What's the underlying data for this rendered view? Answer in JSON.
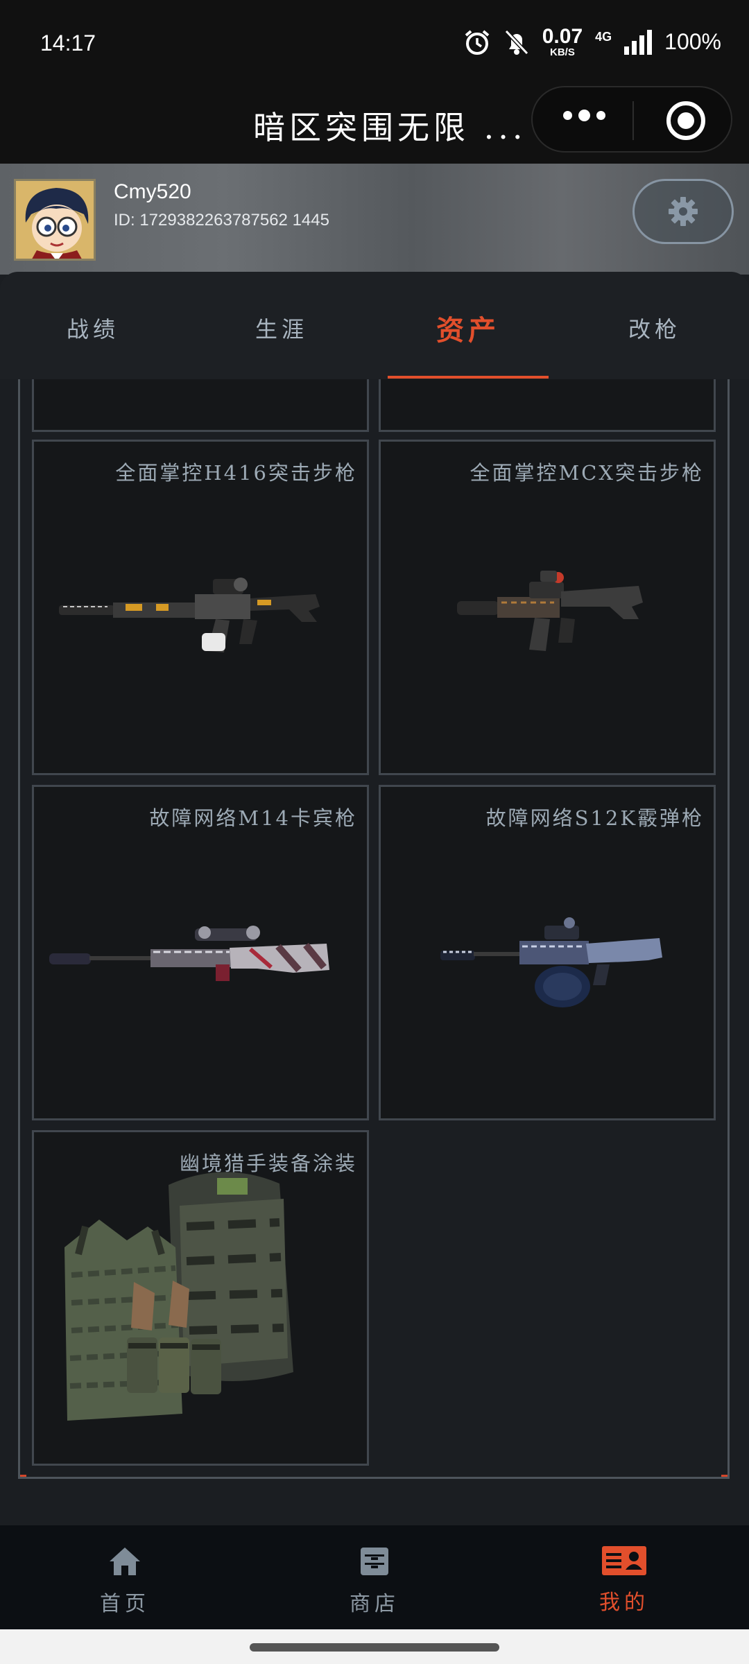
{
  "status_bar": {
    "time": "14:17",
    "speed_value": "0.07",
    "speed_unit": "KB/S",
    "network": "4G",
    "battery": "100%",
    "icons": [
      "alarm-icon",
      "bell-off-icon",
      "signal-icon"
    ]
  },
  "title_bar": {
    "title": "暗区突围无限 ..."
  },
  "profile": {
    "username": "Cmy520",
    "id": "ID: 1729382263787562 1445"
  },
  "tabs": [
    {
      "label": "战绩",
      "active": false
    },
    {
      "label": "生涯",
      "active": false
    },
    {
      "label": "资产",
      "active": true
    },
    {
      "label": "改枪",
      "active": false
    }
  ],
  "assets": [
    {
      "name": "全面掌控H416突击步枪",
      "type": "rifle"
    },
    {
      "name": "全面掌控MCX突击步枪",
      "type": "rifle"
    },
    {
      "name": "故障网络M14卡宾枪",
      "type": "rifle"
    },
    {
      "name": "故障网络S12K霰弹枪",
      "type": "shotgun"
    },
    {
      "name": "幽境猎手装备涂装",
      "type": "gear"
    }
  ],
  "bottom_nav": [
    {
      "label": "首页",
      "icon": "home-icon",
      "active": false
    },
    {
      "label": "商店",
      "icon": "store-icon",
      "active": false
    },
    {
      "label": "我的",
      "icon": "profile-card-icon",
      "active": true
    }
  ],
  "colors": {
    "accent": "#e24f2c",
    "background": "#1b1e22",
    "card": "#151719"
  }
}
